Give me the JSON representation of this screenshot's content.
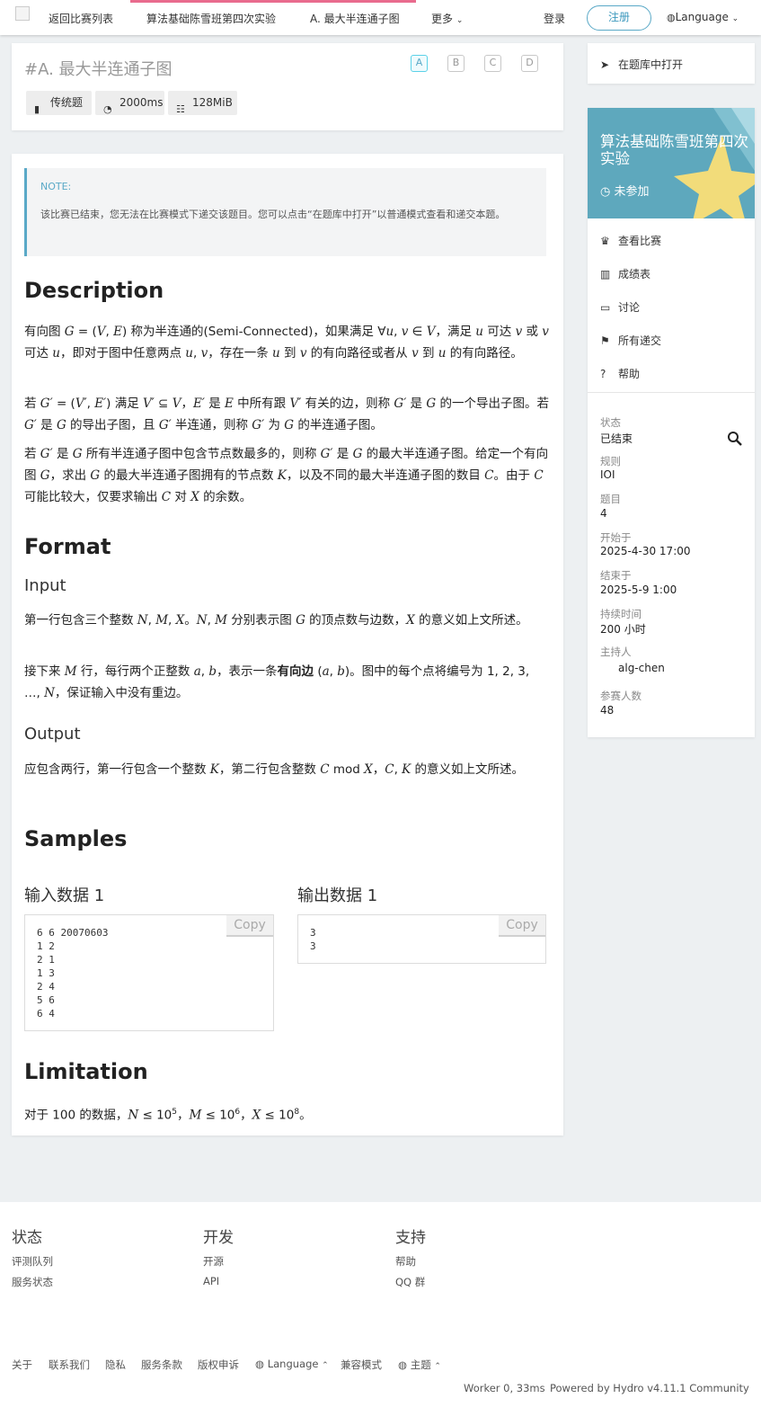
{
  "nav": {
    "back": "返回比赛列表",
    "contest": "算法基础陈雪班第四次实验",
    "problem": "A. 最大半连通子图",
    "more": "更多",
    "login": "登录",
    "register": "注册",
    "language": "Language",
    "accent": "#e96b8e"
  },
  "problem": {
    "title": "#A. 最大半连通子图",
    "tabs": [
      "A",
      "B",
      "C",
      "D"
    ],
    "type": "传统题",
    "time": "2000ms",
    "memory": "128MiB"
  },
  "note": {
    "heading": "NOTE:",
    "text": "该比赛已结束，您无法在比赛模式下递交该题目。您可以点击“在题库中打开”以普通模式查看和递交本题。"
  },
  "sections": {
    "description": "Description",
    "format": "Format",
    "input": "Input",
    "output": "Output",
    "samples": "Samples",
    "limitation": "Limitation"
  },
  "samples": {
    "in_title": "输入数据 1",
    "out_title": "输出数据 1",
    "copy": "Copy",
    "input": "6 6 20070603\n1 2\n2 1\n1 3\n2 4\n5 6\n6 4",
    "output": "3\n3"
  },
  "sidebar": {
    "open_in_bank": "在题库中打开",
    "contest_title": "算法基础陈雪班第四次实验",
    "status_badge": "未参加",
    "menu": [
      "查看比赛",
      "成绩表",
      "讨论",
      "所有递交",
      "帮助"
    ],
    "info": [
      {
        "label": "状态",
        "value": "已结束"
      },
      {
        "label": "规则",
        "value": "IOI"
      },
      {
        "label": "题目",
        "value": "4"
      },
      {
        "label": "开始于",
        "value": "2025-4-30 17:00"
      },
      {
        "label": "结束于",
        "value": "2025-5-9 1:00"
      },
      {
        "label": "持续时间",
        "value": "200 小时"
      },
      {
        "label": "主持人",
        "value": "alg-chen"
      },
      {
        "label": "参赛人数",
        "value": "48"
      }
    ],
    "banner_color": "#5ea8bd"
  },
  "footer": {
    "col1": {
      "title": "状态",
      "links": [
        "评测队列",
        "服务状态"
      ]
    },
    "col2": {
      "title": "开发",
      "links": [
        "开源",
        "API"
      ]
    },
    "col3": {
      "title": "支持",
      "links": [
        "帮助",
        "QQ 群"
      ]
    },
    "bottom": [
      "关于",
      "联系我们",
      "隐私",
      "服务条款",
      "版权申诉",
      "Language",
      "兼容模式",
      "主题"
    ],
    "worker": "Worker 0, 33ms",
    "powered": "Powered by Hydro v4.11.1 Community"
  }
}
